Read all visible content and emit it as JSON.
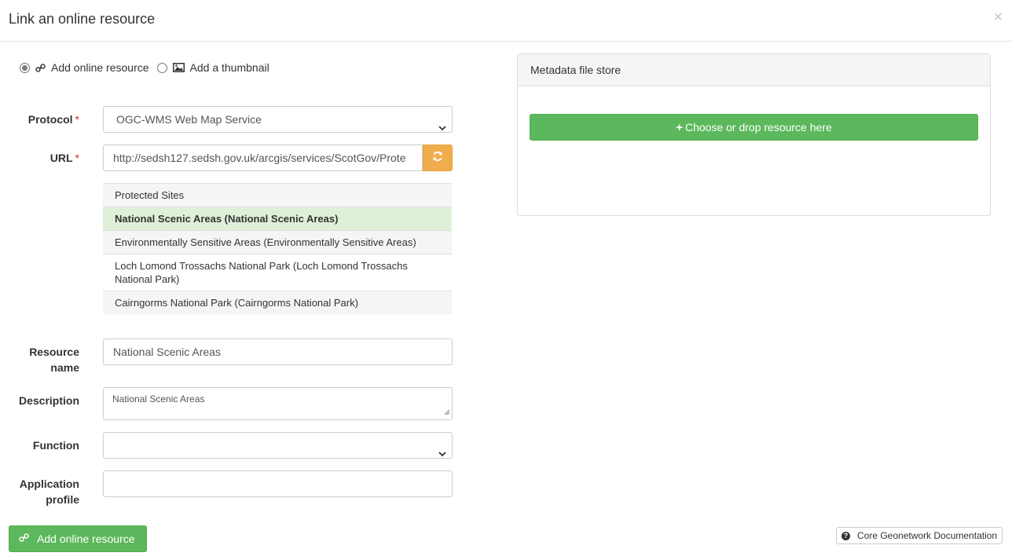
{
  "dialog": {
    "title": "Link an online resource",
    "close_glyph": "×"
  },
  "mode": {
    "options": [
      {
        "label": "Add online resource",
        "selected": true,
        "icon": "link-icon"
      },
      {
        "label": "Add a thumbnail",
        "selected": false,
        "icon": "image-icon"
      }
    ]
  },
  "form": {
    "protocol": {
      "label": "Protocol",
      "required_mark": "*",
      "value": "OGC-WMS Web Map Service"
    },
    "url": {
      "label": "URL",
      "required_mark": "*",
      "value": "http://sedsh127.sedsh.gov.uk/arcgis/services/ScotGov/Prote",
      "refresh_icon": "refresh-icon"
    },
    "layers": [
      {
        "label": "Protected Sites",
        "state": "normal"
      },
      {
        "label": "National Scenic Areas (National Scenic Areas)",
        "state": "selected"
      },
      {
        "label": "Environmentally Sensitive Areas (Environmentally Sensitive Areas)",
        "state": "normal"
      },
      {
        "label": "Loch Lomond Trossachs National Park (Loch Lomond Trossachs National Park)",
        "state": "white"
      },
      {
        "label": "Cairngorms National Park (Cairngorms National Park)",
        "state": "normal"
      }
    ],
    "resource_name": {
      "label_line1": "Resource",
      "label_line2": "name",
      "value": "National Scenic Areas"
    },
    "description": {
      "label": "Description",
      "value": "National Scenic Areas"
    },
    "function": {
      "label": "Function",
      "value": ""
    },
    "application_profile": {
      "label_line1": "Application",
      "label_line2": "profile",
      "value": ""
    },
    "submit_label": "Add online resource"
  },
  "filestore": {
    "heading": "Metadata file store",
    "drop_label": "Choose or drop resource here",
    "drop_icon_glyph": "+"
  },
  "footer": {
    "doc_label": "Core Geonetwork Documentation",
    "doc_icon_glyph": "?"
  },
  "colors": {
    "success": "#5cb85c",
    "warning": "#f0ad4e",
    "selected_row": "#dff0d8"
  }
}
